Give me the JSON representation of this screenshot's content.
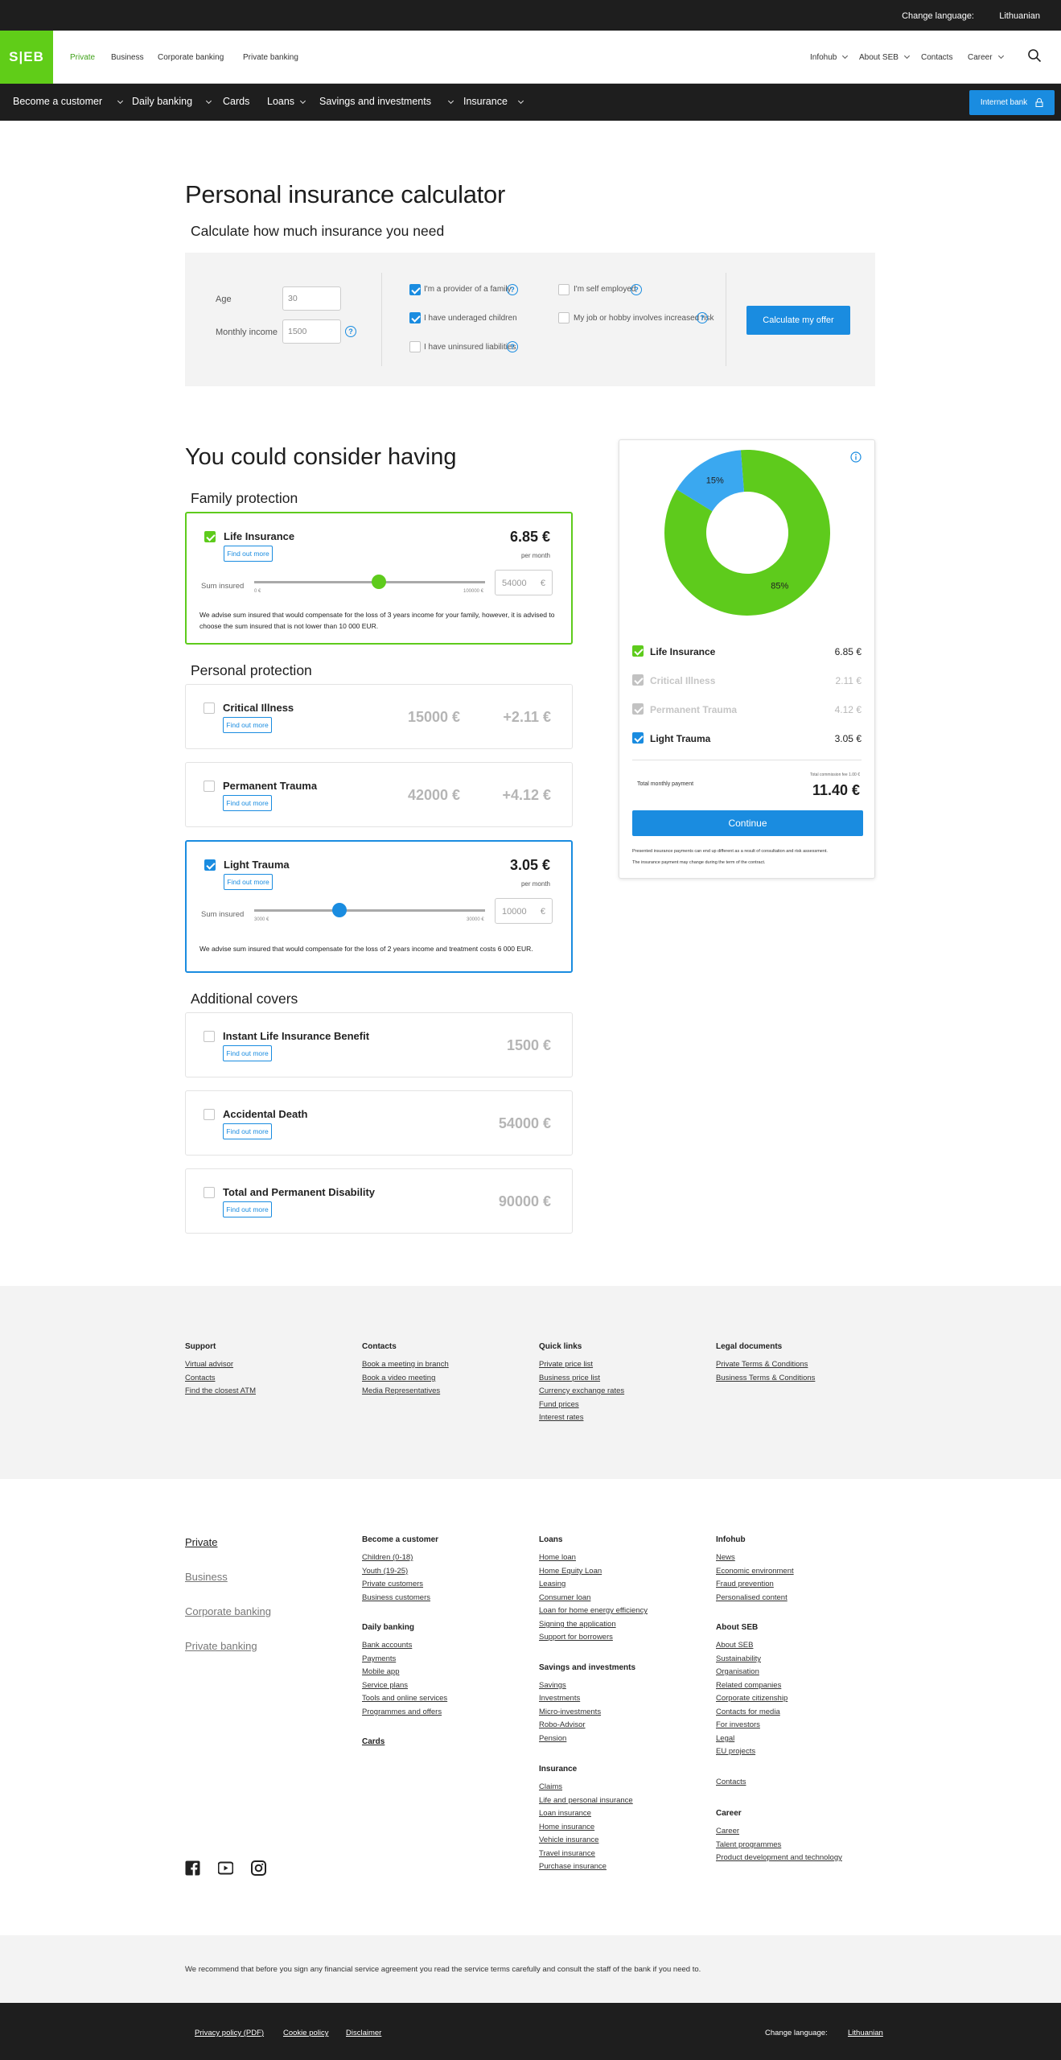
{
  "topbar": {
    "lang_label": "Change language:",
    "lang_value": "Lithuanian"
  },
  "header": {
    "logo": "S|EB",
    "segments": [
      "Private",
      "Business",
      "Corporate banking",
      "Private banking"
    ],
    "right_nav": [
      "Infohub",
      "About SEB",
      "Contacts",
      "Career"
    ]
  },
  "mainnav": {
    "items": [
      "Become a customer",
      "Daily banking",
      "Cards",
      "Loans",
      "Savings and investments",
      "Insurance"
    ],
    "internet_bank": "Internet bank"
  },
  "calculator": {
    "title": "Personal insurance calculator",
    "subtitle": "Calculate how much insurance you need",
    "age_label": "Age",
    "age_placeholder": "30",
    "income_label": "Monthly income",
    "income_placeholder": "1500",
    "options": [
      {
        "label": "I'm a provider of a family",
        "checked": true
      },
      {
        "label": "I have underaged children",
        "checked": true
      },
      {
        "label": "I have uninsured liabilities",
        "checked": false
      },
      {
        "label": "I'm self employed",
        "checked": false
      },
      {
        "label": "My job or hobby involves increased risk",
        "checked": false
      }
    ],
    "button": "Calculate my offer"
  },
  "offer": {
    "title": "You could consider having",
    "family_heading": "Family protection",
    "personal_heading": "Personal protection",
    "additional_heading": "Additional covers",
    "find_out_more": "Find out more",
    "per_month": "per month",
    "sum_insured_label": "Sum insured",
    "eur": "€",
    "life": {
      "title": "Life Insurance",
      "price": "6.85 €",
      "slider_min": "0 €",
      "slider_max": "100000 €",
      "sum": "54000",
      "slider_value_fraction": 0.54,
      "advice": "We advise sum insured that would compensate for the loss of 3 years income for your family, however, it is advised to choose the sum insured that is not lower than 10 000 EUR."
    },
    "critical": {
      "title": "Critical Illness",
      "sum": "15000 €",
      "price": "+2.11 €"
    },
    "permanent": {
      "title": "Permanent Trauma",
      "sum": "42000 €",
      "price": "+4.12 €"
    },
    "light": {
      "title": "Light Trauma",
      "price": "3.05 €",
      "slider_min": "3000 €",
      "slider_max": "30000 €",
      "sum": "10000",
      "slider_value_fraction": 0.37,
      "advice": "We advise sum insured that would compensate for the loss of 2 years income and treatment costs 6 000 EUR."
    },
    "instant": {
      "title": "Instant Life Insurance Benefit",
      "sum": "1500 €"
    },
    "accidental": {
      "title": "Accidental Death",
      "sum": "54000 €"
    },
    "tpd": {
      "title": "Total and Permanent Disability",
      "sum": "90000 €"
    }
  },
  "summary": {
    "donut": {
      "green_pct": 85,
      "blue_pct": 15,
      "green_label": "85%",
      "blue_label": "15%",
      "green_color": "#5ecb1c",
      "blue_color": "#3aa8f0"
    },
    "rows": [
      {
        "label": "Life Insurance",
        "value": "6.85 €"
      },
      {
        "label": "Critical Illness",
        "value": "2.11 €"
      },
      {
        "label": "Permanent Trauma",
        "value": "4.12 €"
      },
      {
        "label": "Light Trauma",
        "value": "3.05 €"
      }
    ],
    "total_label": "Total monthly payment",
    "total_note": "Total commission fee 1.00 €",
    "total_value": "11.40 €",
    "continue": "Continue",
    "disclaimer_1": "Presented insurance payments can end up different as a result of consultation and risk assessment.",
    "disclaimer_2": "The insurance payment may change during the term of the contract."
  },
  "footer_links": {
    "support": {
      "heading": "Support",
      "items": [
        "Virtual advisor",
        "Contacts",
        "Find the closest ATM"
      ]
    },
    "contacts": {
      "heading": "Contacts",
      "items": [
        "Book a meeting in branch",
        "Book a video meeting",
        "Media Representatives"
      ]
    },
    "quick": {
      "heading": "Quick links",
      "items": [
        "Private price list",
        "Business price list",
        "Currency exchange rates",
        "Fund prices",
        "Interest rates"
      ]
    },
    "legal": {
      "heading": "Legal documents",
      "items": [
        "Private Terms & Conditions",
        "Business Terms & Conditions"
      ]
    }
  },
  "sitemap": {
    "segments": [
      "Private",
      "Business",
      "Corporate banking",
      "Private banking"
    ],
    "become": {
      "heading": "Become a customer",
      "items": [
        "Children (0-18)",
        "Youth (19-25)",
        "Private customers",
        "Business customers"
      ]
    },
    "daily": {
      "heading": "Daily banking",
      "items": [
        "Bank accounts",
        "Payments",
        "Mobile app",
        "Service plans",
        "Tools and online services",
        "Programmes and offers"
      ]
    },
    "cards": {
      "heading": "Cards"
    },
    "loans": {
      "heading": "Loans",
      "items": [
        "Home loan",
        "Home Equity Loan",
        "Leasing",
        "Consumer loan",
        "Loan for home energy efficiency",
        "Signing the application",
        "Support for borrowers"
      ]
    },
    "savings": {
      "heading": "Savings and investments",
      "items": [
        "Savings",
        "Investments",
        "Micro-investments",
        "Robo-Advisor",
        "Pension"
      ]
    },
    "insurance": {
      "heading": "Insurance",
      "items": [
        "Claims",
        "Life and personal insurance",
        "Loan insurance",
        "Home insurance",
        "Vehicle insurance",
        "Travel insurance",
        "Purchase insurance"
      ]
    },
    "infohub": {
      "heading": "Infohub",
      "items": [
        "News",
        "Economic environment",
        "Fraud prevention",
        "Personalised content"
      ]
    },
    "about": {
      "heading": "About SEB",
      "items": [
        "About SEB",
        "Sustainability",
        "Organisation",
        "Related companies",
        "Corporate citizenship",
        "Contacts for media",
        "For investors",
        "Legal",
        "EU projects"
      ]
    },
    "contacts": "Contacts",
    "career": {
      "heading": "Career",
      "items": [
        "Career",
        "Talent programmes",
        "Product development and technology"
      ]
    }
  },
  "recommend": "We recommend that before you sign any financial service agreement you read the service terms carefully and consult the staff of the bank if you need to.",
  "bottom": {
    "links": [
      "Privacy policy (PDF)",
      "Cookie policy",
      "Disclaimer"
    ],
    "lang_label": "Change language:",
    "lang_value": "Lithuanian"
  },
  "colors": {
    "brand_green": "#60cd18",
    "accent_blue": "#1a8ce0",
    "dark": "#1e1e1e"
  }
}
